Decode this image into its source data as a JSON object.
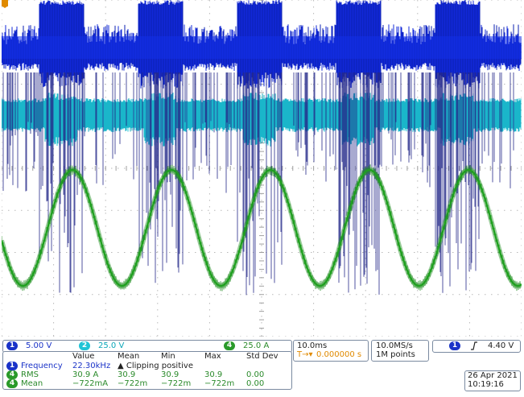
{
  "channels": {
    "ch1": {
      "num": "1",
      "scale": "5.00 V",
      "color": "#1a33c8"
    },
    "ch2": {
      "num": "2",
      "scale": "25.0 V",
      "color": "#0aa6b8"
    },
    "ch4": {
      "num": "4",
      "scale": "25.0 A",
      "color": "#2a9a2a"
    }
  },
  "timebase": {
    "scale": "10.0ms",
    "delay": "0.000000 s",
    "delay_icon": "T→▾"
  },
  "acquisition": {
    "rate": "10.0MS/s",
    "points": "1M points"
  },
  "trigger": {
    "source": "1",
    "slope_icon": "rising-edge-icon",
    "level": "4.40 V"
  },
  "measurements": {
    "headers": [
      "Value",
      "Mean",
      "Min",
      "Max",
      "Std Dev"
    ],
    "warning": "▲ Clipping positive",
    "rows": [
      {
        "ch": "1",
        "name": "Frequency",
        "value": "22.30kHz",
        "mean": "",
        "min": "",
        "max": "",
        "std": "",
        "color": "#1a33c8"
      },
      {
        "ch": "4",
        "name": "RMS",
        "value": "30.9 A",
        "mean": "30.9",
        "min": "30.9",
        "max": "30.9",
        "std": "0.00",
        "color": "#2a9a2a"
      },
      {
        "ch": "4",
        "name": "Mean",
        "value": "−722mA",
        "mean": "−722m",
        "min": "−722m",
        "max": "−722m",
        "std": "0.00",
        "color": "#2a9a2a"
      }
    ]
  },
  "datetime": {
    "date": "26 Apr 2021",
    "time": "10:19:16"
  }
}
